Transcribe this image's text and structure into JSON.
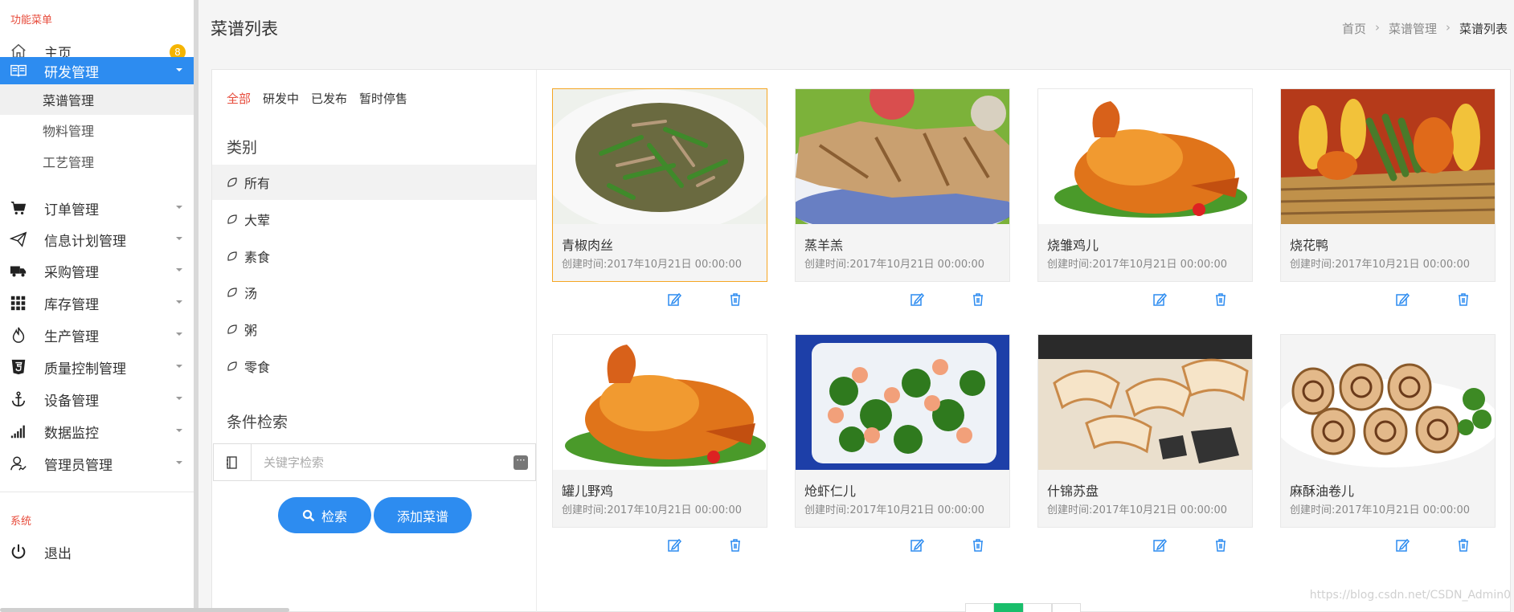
{
  "sidebar": {
    "section_menu": "功能菜单",
    "section_system": "系统",
    "items": [
      {
        "label": "主页",
        "badge": "8"
      },
      {
        "label": "研发管理"
      },
      {
        "label": "订单管理"
      },
      {
        "label": "信息计划管理"
      },
      {
        "label": "采购管理"
      },
      {
        "label": "库存管理"
      },
      {
        "label": "生产管理"
      },
      {
        "label": "质量控制管理"
      },
      {
        "label": "设备管理"
      },
      {
        "label": "数据监控"
      },
      {
        "label": "管理员管理"
      }
    ],
    "sub_items": [
      "菜谱管理",
      "物料管理",
      "工艺管理"
    ],
    "logout": "退出"
  },
  "header": {
    "title": "菜谱列表",
    "breadcrumb": [
      "首页",
      "菜谱管理",
      "菜谱列表"
    ]
  },
  "filters": {
    "status_tabs": [
      "全部",
      "研发中",
      "已发布",
      "暂时停售"
    ],
    "category_title": "类别",
    "categories": [
      "所有",
      "大荤",
      "素食",
      "汤",
      "粥",
      "零食"
    ],
    "condition_title": "条件检索",
    "search_placeholder": "关键字检索",
    "search_button": "检索",
    "add_button": "添加菜谱"
  },
  "recipes": [
    {
      "name": "青椒肉丝",
      "created": "创建时间:2017年10月21日 00:00:00"
    },
    {
      "name": "蒸羊羔",
      "created": "创建时间:2017年10月21日 00:00:00"
    },
    {
      "name": "烧雏鸡儿",
      "created": "创建时间:2017年10月21日 00:00:00"
    },
    {
      "name": "烧花鸭",
      "created": "创建时间:2017年10月21日 00:00:00"
    },
    {
      "name": "罐儿野鸡",
      "created": "创建时间:2017年10月21日 00:00:00"
    },
    {
      "name": "炝虾仁儿",
      "created": "创建时间:2017年10月21日 00:00:00"
    },
    {
      "name": "什锦苏盘",
      "created": "创建时间:2017年10月21日 00:00:00"
    },
    {
      "name": "麻酥油卷儿",
      "created": "创建时间:2017年10月21日 00:00:00"
    }
  ],
  "watermark": "https://blog.csdn.net/CSDN_Admin0",
  "colors": {
    "accent": "#2d8cf0",
    "active_tab": "#e74c3c",
    "badge": "#f5b400",
    "selected_card": "#f5a623",
    "pager_active": "#19be6b"
  }
}
